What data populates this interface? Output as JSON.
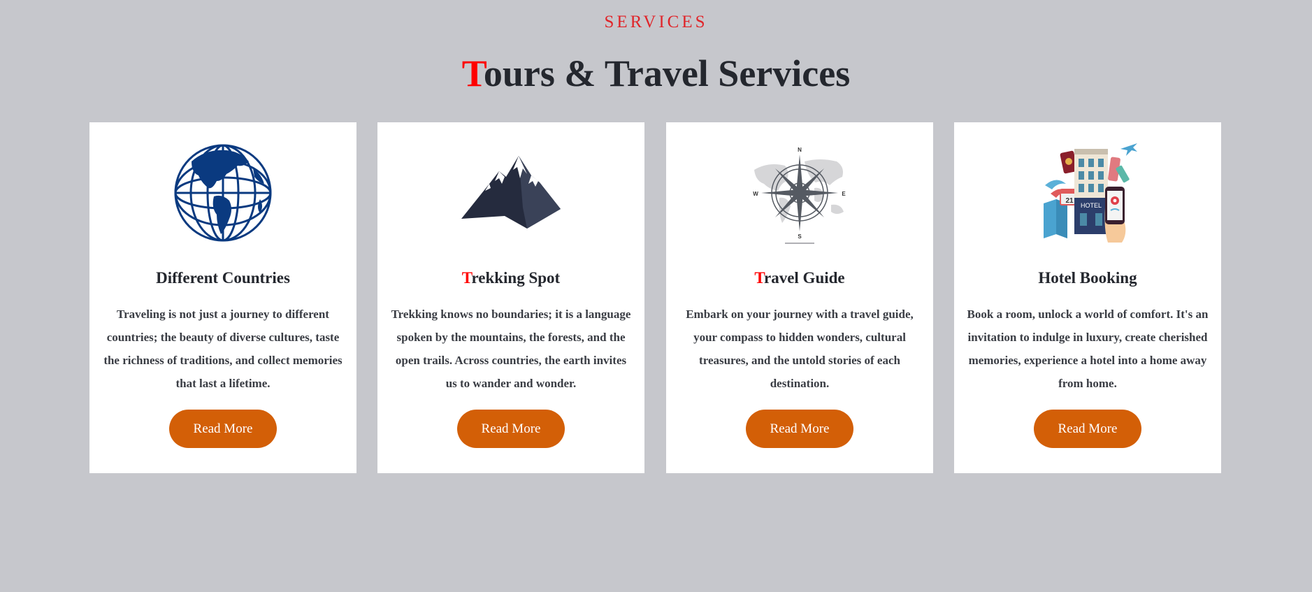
{
  "section": {
    "eyebrow": "SERVICES",
    "title_first": "T",
    "title_rest": "ours & Travel Services"
  },
  "colors": {
    "accent": "#ff0000",
    "button": "#d35f07",
    "background": "#c6c7cc"
  },
  "cards": [
    {
      "icon": "globe-icon",
      "title_first": "D",
      "title_rest": "ifferent Countries",
      "title_first_accent": false,
      "text": "Traveling is not just a journey to different countries; the beauty of diverse cultures, taste the richness of traditions, and collect memories that last a lifetime.",
      "button": "Read More"
    },
    {
      "icon": "mountain-icon",
      "title_first": "T",
      "title_rest": "rekking Spot",
      "title_first_accent": true,
      "text": "Trekking knows no boundaries; it is a language spoken by the mountains, the forests, and the open trails. Across countries, the earth invites us to wander and wonder.",
      "button": "Read More"
    },
    {
      "icon": "compass-icon",
      "title_first": "T",
      "title_rest": "ravel Guide",
      "title_first_accent": true,
      "text": "Embark on your journey with a travel guide, your compass to hidden wonders, cultural treasures, and the untold stories of each destination.",
      "button": "Read More",
      "compass_labels": [
        "N",
        "E",
        "S",
        "W"
      ]
    },
    {
      "icon": "hotel-booking-icon",
      "title_first": "H",
      "title_rest": "otel Booking",
      "title_first_accent": false,
      "text": "Book a room, unlock a world of comfort. It's an invitation to indulge in luxury, create cherished memories, experience a hotel into a home away from home.",
      "button": "Read More",
      "illustration_text": [
        "HOTEL",
        "21"
      ]
    }
  ]
}
